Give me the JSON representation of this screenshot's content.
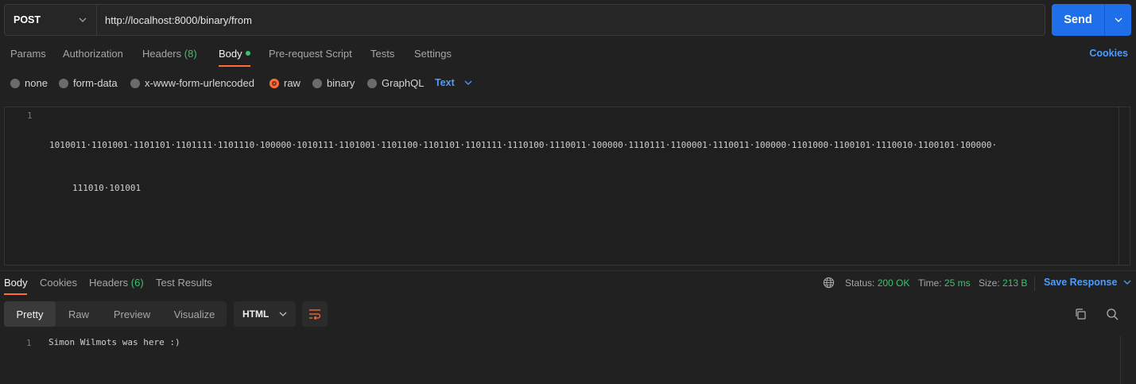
{
  "request": {
    "method": "POST",
    "url": "http://localhost:8000/binary/from",
    "send_label": "Send"
  },
  "request_tabs": [
    {
      "label": "Params"
    },
    {
      "label": "Authorization"
    },
    {
      "label": "Headers",
      "count": "(8)"
    },
    {
      "label": "Body"
    },
    {
      "label": "Pre-request Script"
    },
    {
      "label": "Tests"
    },
    {
      "label": "Settings"
    }
  ],
  "cookies_label": "Cookies",
  "body_types": [
    {
      "label": "none"
    },
    {
      "label": "form-data"
    },
    {
      "label": "x-www-form-urlencoded"
    },
    {
      "label": "raw"
    },
    {
      "label": "binary"
    },
    {
      "label": "GraphQL"
    }
  ],
  "raw_format": "Text",
  "editor": {
    "line_number": "1",
    "line1": "1010011·1101001·1101101·1101111·1101110·100000·1010111·1101001·1101100·1101101·1101111·1110100·1110011·100000·1110111·1100001·1110011·100000·1101000·1100101·1110010·1100101·100000·",
    "line1_wrap": "111010·101001"
  },
  "response_tabs": [
    {
      "label": "Body"
    },
    {
      "label": "Cookies"
    },
    {
      "label": "Headers",
      "count": "(6)"
    },
    {
      "label": "Test Results"
    }
  ],
  "response_meta": {
    "status_label": "Status:",
    "status_value": "200 OK",
    "time_label": "Time:",
    "time_value": "25 ms",
    "size_label": "Size:",
    "size_value": "213 B",
    "save_label": "Save Response"
  },
  "view_modes": [
    "Pretty",
    "Raw",
    "Preview",
    "Visualize"
  ],
  "response_language": "HTML",
  "response_body": {
    "line_number": "1",
    "text": "Simon Wilmots was here :)"
  },
  "colors": {
    "accent": "#ff6c37",
    "primary": "#1f6feb",
    "link": "#4d9cff",
    "success": "#3cc26c"
  }
}
